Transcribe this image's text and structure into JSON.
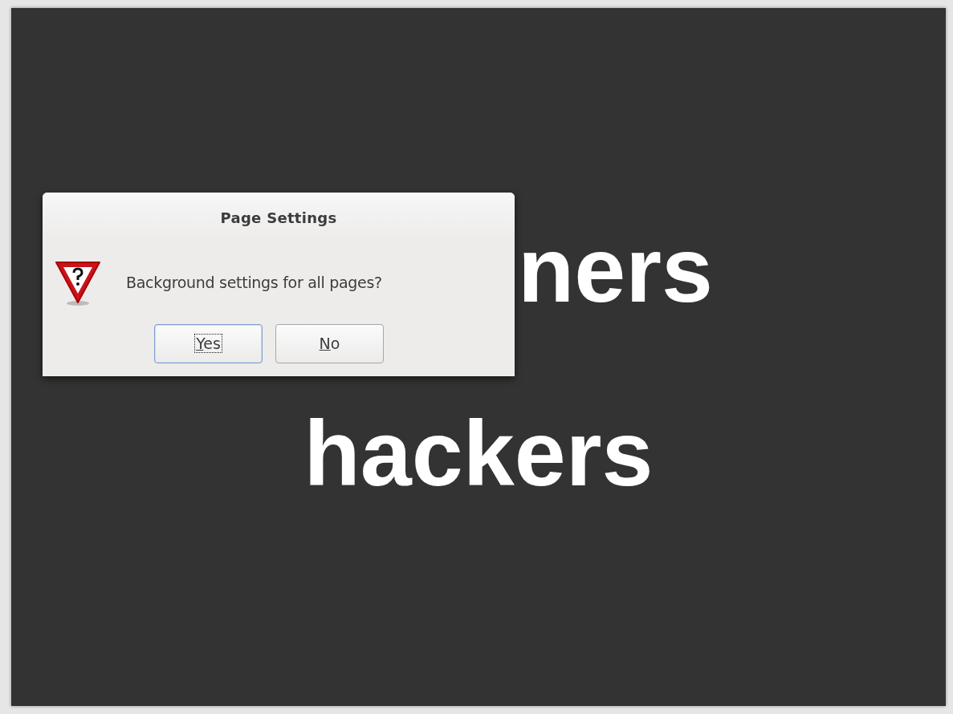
{
  "slide": {
    "lines": [
      {
        "text": "ners",
        "kind": "partial"
      },
      {
        "text": "hackers",
        "kind": "whole"
      }
    ]
  },
  "dialog": {
    "title": "Page Settings",
    "message": "Background settings for all pages?",
    "buttons": [
      {
        "label": "Yes",
        "focused": true
      },
      {
        "label": "No",
        "focused": false
      }
    ]
  }
}
